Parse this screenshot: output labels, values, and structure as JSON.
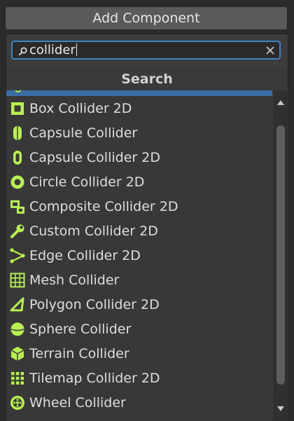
{
  "add_component_button": {
    "label": "Add Component"
  },
  "search": {
    "value": "collider"
  },
  "header": {
    "title": "Search"
  },
  "colors": {
    "accent": "#3d83c6",
    "icon": "#b8f050",
    "selection": "#3b6ea6"
  },
  "items": [
    {
      "label": "Box Collider 2D",
      "icon": "box-collider-2d-icon"
    },
    {
      "label": "Capsule Collider",
      "icon": "capsule-collider-icon"
    },
    {
      "label": "Capsule Collider 2D",
      "icon": "capsule-collider-2d-icon"
    },
    {
      "label": "Circle Collider 2D",
      "icon": "circle-collider-2d-icon"
    },
    {
      "label": "Composite Collider 2D",
      "icon": "composite-collider-2d-icon"
    },
    {
      "label": "Custom Collider 2D",
      "icon": "custom-collider-2d-icon"
    },
    {
      "label": "Edge Collider 2D",
      "icon": "edge-collider-2d-icon"
    },
    {
      "label": "Mesh Collider",
      "icon": "mesh-collider-icon"
    },
    {
      "label": "Polygon Collider 2D",
      "icon": "polygon-collider-2d-icon"
    },
    {
      "label": "Sphere Collider",
      "icon": "sphere-collider-icon"
    },
    {
      "label": "Terrain Collider",
      "icon": "terrain-collider-icon"
    },
    {
      "label": "Tilemap Collider 2D",
      "icon": "tilemap-collider-2d-icon"
    },
    {
      "label": "Wheel Collider",
      "icon": "wheel-collider-icon"
    }
  ]
}
